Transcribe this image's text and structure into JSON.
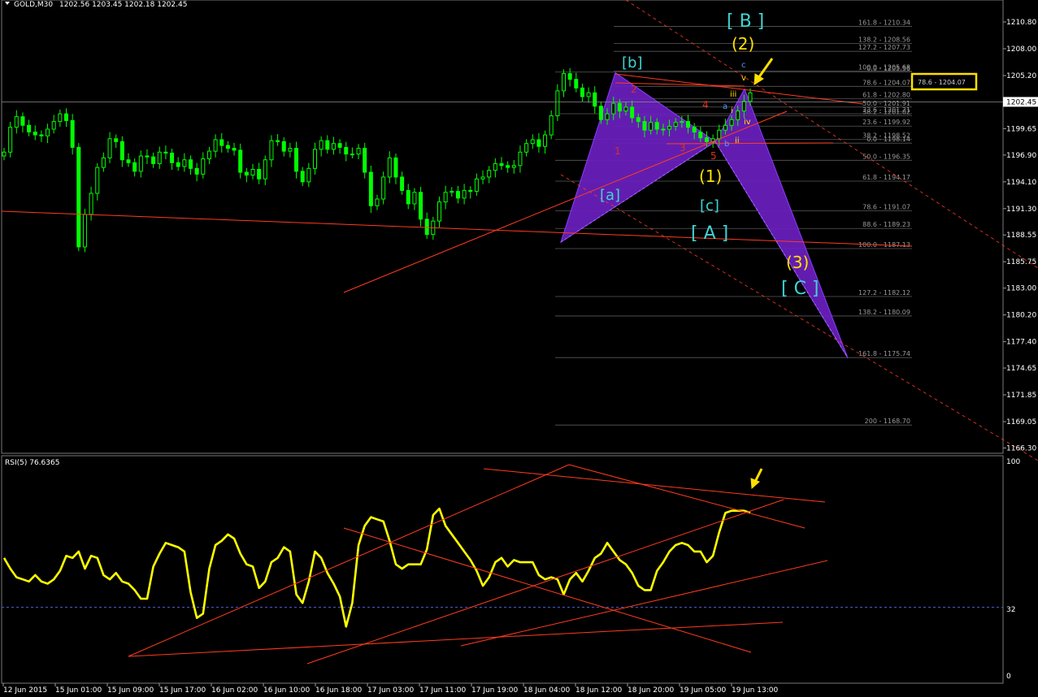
{
  "header": {
    "symbol_label": "GOLD,M30",
    "ohlc": "1202.56 1203.45 1202.18 1202.45"
  },
  "rsi_panel": {
    "label": "RSI(5) 76.6365",
    "levels": [
      "100",
      "32",
      "0"
    ]
  },
  "price_axis": {
    "ticks": [
      "1210.80",
      "1208.00",
      "1205.20",
      "1202.45",
      "1199.65",
      "1196.90",
      "1194.10",
      "1191.30",
      "1188.55",
      "1185.75",
      "1183.00",
      "1180.20",
      "1177.40",
      "1174.65",
      "1171.85",
      "1169.05",
      "1166.30"
    ],
    "current_price": "1202.45",
    "highlight_box": "78.6 - 1204.07"
  },
  "time_axis": {
    "ticks": [
      "12 Jun 2015",
      "15 Jun 01:00",
      "15 Jun 09:00",
      "15 Jun 17:00",
      "16 Jun 02:00",
      "16 Jun 10:00",
      "16 Jun 18:00",
      "17 Jun 03:00",
      "17 Jun 11:00",
      "17 Jun 19:00",
      "18 Jun 04:00",
      "18 Jun 12:00",
      "18 Jun 20:00",
      "19 Jun 05:00",
      "19 Jun 13:00"
    ]
  },
  "fib_levels": [
    "161.8 - 1210.34",
    "138.2 - 1208.56",
    "127.2 - 1207.73",
    "0.0 - 1205.56",
    "100.0 - 1205.68",
    "78.6 - 1204.07",
    "61.8 - 1202.80",
    "50.0 - 1201.91",
    "23.6 - 1201.21",
    "38.2 - 1201.02",
    "23.6 - 1199.92",
    "38.2 - 1198.52",
    "0.0 - 1198.14",
    "50.0 - 1196.35",
    "61.8 - 1194.17",
    "78.6 - 1191.07",
    "88.6 - 1189.23",
    "100.0 - 1187.13",
    "127.2 - 1182.12",
    "138.2 - 1180.09",
    "161.8 - 1175.74",
    "200 - 1168.70"
  ],
  "wave_labels": {
    "B_big": "[ B ]",
    "two": "(2)",
    "b_small": "[b]",
    "a_small": "[a]",
    "one": "(1)",
    "c_small": "[c]",
    "A_big": "[ A ]",
    "three": "(3)",
    "C_big": "[ C ]",
    "c_blue": "c",
    "v": "v",
    "iii": "iii",
    "iv": "iv",
    "ii": "ii",
    "i": "i",
    "a_blue": "a",
    "b_blue": "b",
    "r1": "1",
    "r2": "2",
    "r3": "3",
    "r4": "4",
    "r5": "5"
  },
  "colors": {
    "background": "#000000",
    "bull_candle": "#00ff00",
    "rsi_line": "#ffff00",
    "trendline": "#ff3b1f",
    "pattern_fill": "#6a1fbf",
    "fib_line": "#5a5a5a",
    "wave_cyan": "#3fd3d3",
    "wave_yellow": "#ffe000",
    "wave_red": "#e03020",
    "arrow": "#ffe000"
  },
  "chart_data": {
    "type": "line",
    "title": "GOLD,M30",
    "ylim": [
      1166.3,
      1212.0
    ],
    "series": [
      {
        "name": "GOLD,M30",
        "values": [
          1197.2,
          1199.8,
          1200.9,
          1200.0,
          1199.3,
          1199.0,
          1198.9,
          1199.6,
          1200.4,
          1201.2,
          1200.5,
          1197.7,
          1187.3,
          1190.7,
          1192.9,
          1195.6,
          1196.6,
          1198.6,
          1198.3,
          1196.4,
          1196.1,
          1195.2,
          1196.8,
          1196.7,
          1196.0,
          1197.2,
          1197.1,
          1196.1,
          1195.7,
          1196.4,
          1195.5,
          1194.9,
          1196.5,
          1197.3,
          1198.5,
          1197.9,
          1197.6,
          1197.4,
          1195.1,
          1194.8,
          1195.4,
          1194.4,
          1196.4,
          1198.4,
          1198.3,
          1197.3,
          1197.6,
          1195.2,
          1194.1,
          1195.5,
          1197.5,
          1198.4,
          1197.5,
          1198.1,
          1197.7,
          1197.0,
          1197.0,
          1197.6,
          1195.1,
          1191.6,
          1192.3,
          1194.6,
          1196.6,
          1194.6,
          1193.2,
          1191.8,
          1193.0,
          1190.2,
          1188.6,
          1190.0,
          1192.0,
          1193.0,
          1193.1,
          1192.4,
          1193.2,
          1193.1,
          1194.4,
          1194.6,
          1195.3,
          1196.0,
          1195.8,
          1195.6,
          1195.8,
          1197.2,
          1198.1,
          1198.5,
          1197.8,
          1199.0,
          1201.0,
          1203.6,
          1205.4,
          1204.8,
          1203.9,
          1203.0,
          1203.4,
          1202.0,
          1200.6,
          1201.2,
          1202.3,
          1201.5,
          1201.9,
          1200.8,
          1200.4,
          1199.5,
          1200.3,
          1199.6,
          1199.6,
          1199.9,
          1200.3,
          1200.4,
          1199.8,
          1199.3,
          1198.7,
          1198.3,
          1198.6,
          1199.5,
          1200.0,
          1200.6,
          1201.5,
          1202.5,
          1203.4
        ]
      },
      {
        "name": "RSI(5)",
        "values": [
          55,
          50,
          46,
          45,
          44,
          47,
          44,
          43,
          45,
          49,
          56,
          55,
          58,
          50,
          56,
          55,
          47,
          45,
          48,
          44,
          43,
          40,
          36,
          36,
          51,
          57,
          62,
          61,
          60,
          58,
          39,
          27,
          29,
          50,
          61,
          63,
          66,
          64,
          57,
          52,
          51,
          41,
          44,
          53,
          55,
          60,
          58,
          38,
          34,
          44,
          58,
          55,
          48,
          43,
          37,
          23,
          34,
          61,
          70,
          74,
          73,
          72,
          63,
          52,
          50,
          52,
          52,
          52,
          59,
          75,
          78,
          70,
          66,
          62,
          58,
          54,
          49,
          42,
          46,
          53,
          55,
          51,
          54,
          53,
          53,
          53,
          47,
          45,
          46,
          45,
          38,
          45,
          48,
          44,
          49,
          55,
          57,
          62,
          58,
          54,
          52,
          48,
          42,
          40,
          40,
          49,
          53,
          58,
          61,
          62,
          61,
          58,
          58,
          53,
          56,
          67,
          76,
          77,
          77,
          77,
          76
        ]
      }
    ]
  }
}
